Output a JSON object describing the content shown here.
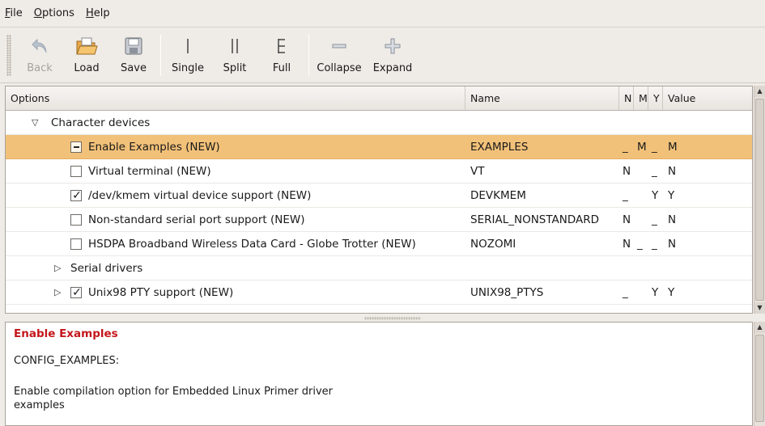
{
  "menu": [
    {
      "label": "File",
      "u": "F",
      "rest": "ile"
    },
    {
      "label": "Options",
      "u": "O",
      "rest": "ptions"
    },
    {
      "label": "Help",
      "u": "H",
      "rest": "elp"
    }
  ],
  "toolbar": {
    "back": "Back",
    "load": "Load",
    "save": "Save",
    "single": "Single",
    "split": "Split",
    "full": "Full",
    "collapse": "Collapse",
    "expand": "Expand"
  },
  "columns": {
    "options": "Options",
    "name": "Name",
    "n": "N",
    "m": "M",
    "y": "Y",
    "value": "Value"
  },
  "rows": [
    {
      "label": "Character devices",
      "name": "",
      "n": "",
      "m": "",
      "y": "",
      "value": ""
    },
    {
      "label": "Enable Examples (NEW)",
      "name": "EXAMPLES",
      "n": "_",
      "m": "M",
      "y": "_",
      "value": "M"
    },
    {
      "label": "Virtual terminal (NEW)",
      "name": "VT",
      "n": "N",
      "m": "",
      "y": "_",
      "value": "N"
    },
    {
      "label": "/dev/kmem virtual device support (NEW)",
      "name": "DEVKMEM",
      "n": "_",
      "m": "",
      "y": "Y",
      "value": "Y"
    },
    {
      "label": "Non-standard serial port support (NEW)",
      "name": "SERIAL_NONSTANDARD",
      "n": "N",
      "m": "",
      "y": "_",
      "value": "N"
    },
    {
      "label": "HSDPA Broadband Wireless Data Card - Globe Trotter (NEW)",
      "name": "NOZOMI",
      "n": "N",
      "m": "_",
      "y": "_",
      "value": "N"
    },
    {
      "label": "Serial drivers",
      "name": "",
      "n": "",
      "m": "",
      "y": "",
      "value": ""
    },
    {
      "label": "Unix98 PTY support (NEW)",
      "name": "UNIX98_PTYS",
      "n": "_",
      "m": "",
      "y": "Y",
      "value": "Y"
    }
  ],
  "description": {
    "title": "Enable Examples",
    "config": "CONFIG_EXAMPLES:",
    "text": "Enable compilation option for Embedded Linux Primer driver examples"
  },
  "colors": {
    "selected_row": "#f2c179",
    "desc_title": "#c4161c"
  }
}
